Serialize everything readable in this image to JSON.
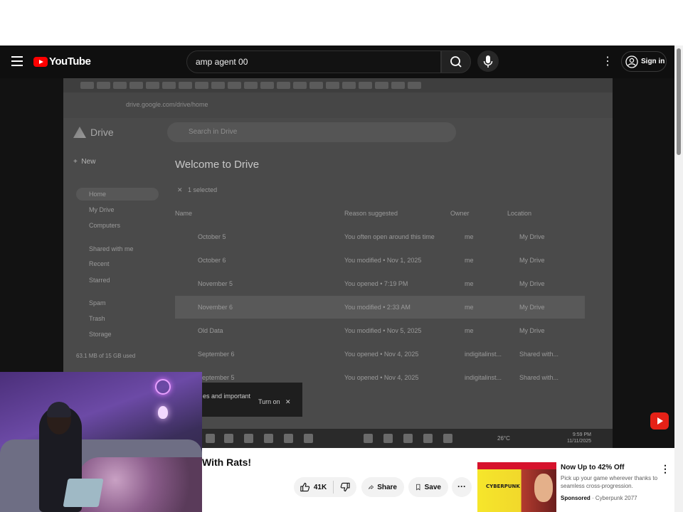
{
  "header": {
    "logo_text": "YouTube",
    "search_value": "amp agent 00",
    "signin_label": "Sign in"
  },
  "screen": {
    "url": "drive.google.com/drive/home",
    "app_name": "Drive",
    "search_placeholder": "Search in Drive",
    "new_label": "New",
    "sidebar": [
      "Home",
      "My Drive",
      "Computers",
      "Shared with me",
      "Recent",
      "Starred",
      "Spam",
      "Trash",
      "Storage"
    ],
    "storage_text": "63.1 MB of 15 GB used",
    "welcome": "Welcome to Drive",
    "selection": "1 selected",
    "columns": [
      "Name",
      "Reason suggested",
      "Owner",
      "Location"
    ],
    "rows": [
      {
        "name": "October 5",
        "reason": "You often open around this time",
        "owner": "me",
        "location": "My Drive"
      },
      {
        "name": "October 6",
        "reason": "You modified • Nov 1, 2025",
        "owner": "me",
        "location": "My Drive"
      },
      {
        "name": "November 5",
        "reason": "You opened • 7:19 PM",
        "owner": "me",
        "location": "My Drive"
      },
      {
        "name": "November 6",
        "reason": "You modified • 2:33 AM",
        "owner": "me",
        "location": "My Drive"
      },
      {
        "name": "Old Data",
        "reason": "You modified • Nov 5, 2025",
        "owner": "me",
        "location": "My Drive"
      },
      {
        "name": "September 6",
        "reason": "You opened • Nov 4, 2025",
        "owner": "indigitalinst...",
        "location": "Shared with..."
      },
      {
        "name": "September 5",
        "reason": "You opened • Nov 4, 2025",
        "owner": "indigitalinst...",
        "location": "Shared with..."
      }
    ],
    "toast_text": "es and important",
    "toast_action": "Turn on",
    "clock_time": "9:59 PM",
    "clock_date": "11/11/2025",
    "weather": "26°C"
  },
  "video": {
    "title": "With Rats!",
    "like_count": "41K",
    "share_label": "Share",
    "save_label": "Save"
  },
  "ad": {
    "thumb_brand": "CYBERPUNK",
    "title": "Now Up to 42% Off",
    "description": "Pick up your game wherever thanks to seamless cross-progression.",
    "sponsored": "Sponsored",
    "advertiser": "Cyberpunk 2077"
  }
}
